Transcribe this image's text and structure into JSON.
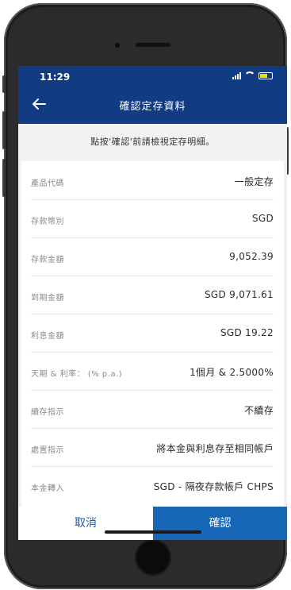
{
  "status_bar": {
    "time": "11:29"
  },
  "header": {
    "title": "確認定存資料",
    "back_icon": "back-arrow-icon"
  },
  "notice": "點按'確認'前請檢視定存明細。",
  "details": [
    {
      "label": "產品代碼",
      "value": "一般定存"
    },
    {
      "label": "存款幣別",
      "value": "SGD"
    },
    {
      "label": "存款金額",
      "value": "9,052.39"
    },
    {
      "label": "到期金額",
      "value": "SGD 9,071.61"
    },
    {
      "label": "利息金額",
      "value": "SGD 19.22"
    },
    {
      "label": "天期 & 利率： (% p.a.)",
      "value": "1個月 & 2.5000%"
    },
    {
      "label": "續存指示",
      "value": "不續存"
    },
    {
      "label": "處置指示",
      "value": "將本金與利息存至相同帳戶"
    },
    {
      "label": "本金轉入",
      "value": "SGD - 隔夜存款帳戶 CHPS"
    }
  ],
  "actions": {
    "cancel": "取消",
    "confirm": "確認"
  },
  "colors": {
    "header_bg": "#123c82",
    "confirm_bg": "#1666b6",
    "cancel_text": "#1f5aa8"
  }
}
